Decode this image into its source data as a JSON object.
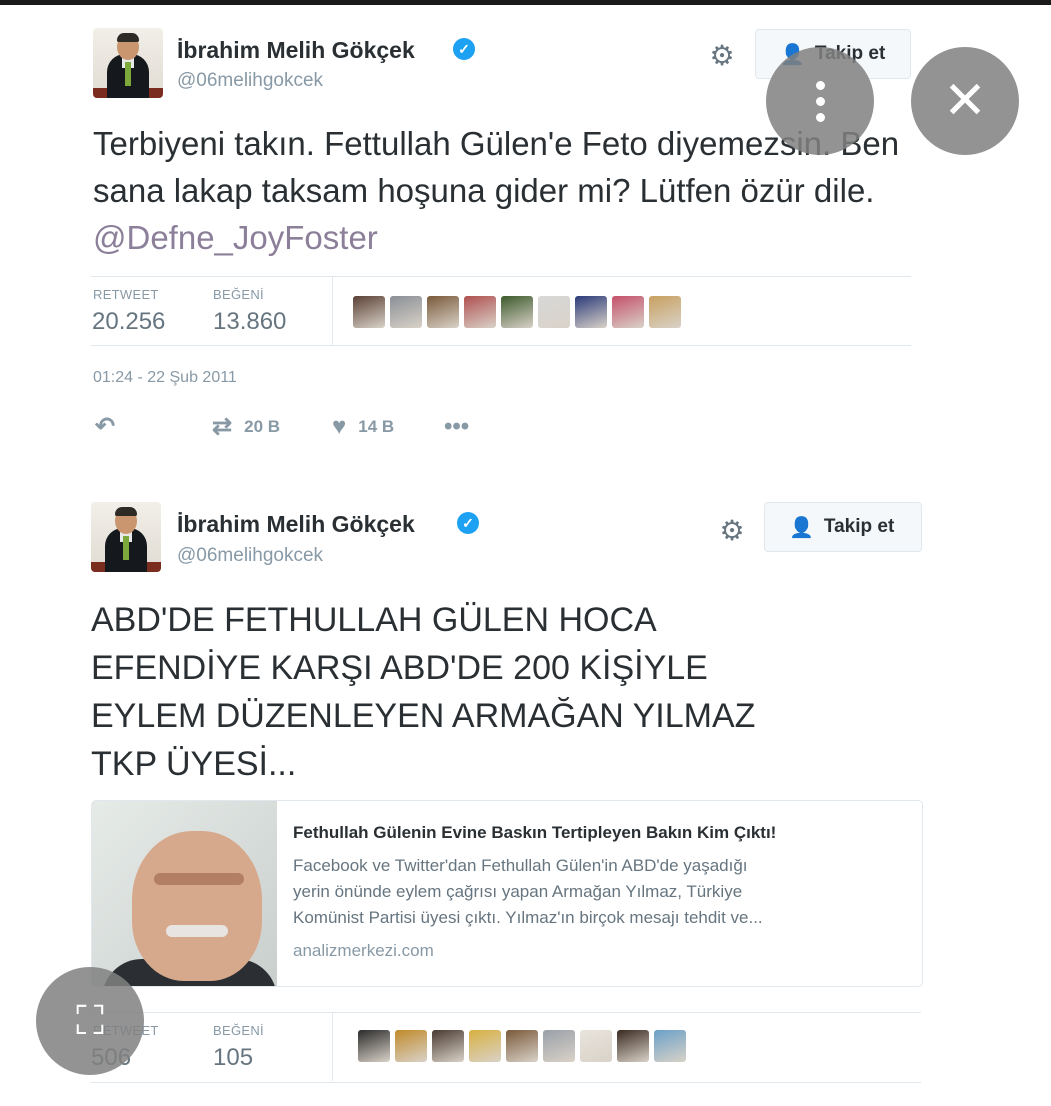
{
  "overlay": {
    "more_icon": "more-vertical-icon",
    "close_icon": "close-icon",
    "lens_icon": "lens-scan-icon"
  },
  "tweets": [
    {
      "author_name": "İbrahim Melih Gökçek",
      "handle": "@06melihgokcek",
      "follow_label": "Takip et",
      "text": "Terbiyeni takın. Fettullah Gülen'e Feto diyemezsin. Ben sana lakap taksam hoşuna gider mi? Lütfen özür dile.",
      "mention": "@Defne_JoyFoster",
      "retweet_label": "RETWEET",
      "retweet_count": "20.256",
      "like_label": "BEĞENİ",
      "like_count": "13.860",
      "timestamp": "01:24 - 22 Şub 2011",
      "actions": {
        "retweets": "20 B",
        "likes": "14 B"
      },
      "liker_colors": [
        "#5a4035",
        "#8a8f96",
        "#7a5a3a",
        "#b05050",
        "#3c5a2c",
        "#d8d8d8",
        "#2a3a7a",
        "#c4506a",
        "#c8a060"
      ]
    },
    {
      "author_name": "İbrahim Melih Gökçek",
      "handle": "@06melihgokcek",
      "follow_label": "Takip et",
      "text_lines": [
        "ABD'DE FETHULLAH GÜLEN HOCA",
        "EFENDİYE KARŞI ABD'DE 200 KİŞİYLE",
        "EYLEM DÜZENLEYEN ARMAĞAN YILMAZ",
        "TKP ÜYESİ..."
      ],
      "card": {
        "title": "Fethullah Gülenin Evine Baskın Tertipleyen Bakın Kim Çıktı!",
        "desc_lines": [
          "Facebook ve Twitter'dan Fethullah Gülen'in ABD'de yaşadığı",
          "yerin önünde eylem çağrısı yapan Armağan Yılmaz, Türkiye",
          "Komünist Partisi üyesi çıktı. Yılmaz'ın birçok mesajı tehdit ve..."
        ],
        "url": "analizmerkezi.com"
      },
      "retweet_label": "RETWEET",
      "retweet_count": "506",
      "like_label": "BEĞENİ",
      "like_count": "105",
      "liker_colors": [
        "#2a2a2a",
        "#c08a2a",
        "#4a3a30",
        "#d8b040",
        "#7a5a3a",
        "#9aa0a8",
        "#e8e4dc",
        "#3a2a20",
        "#6aa0c8"
      ]
    }
  ]
}
